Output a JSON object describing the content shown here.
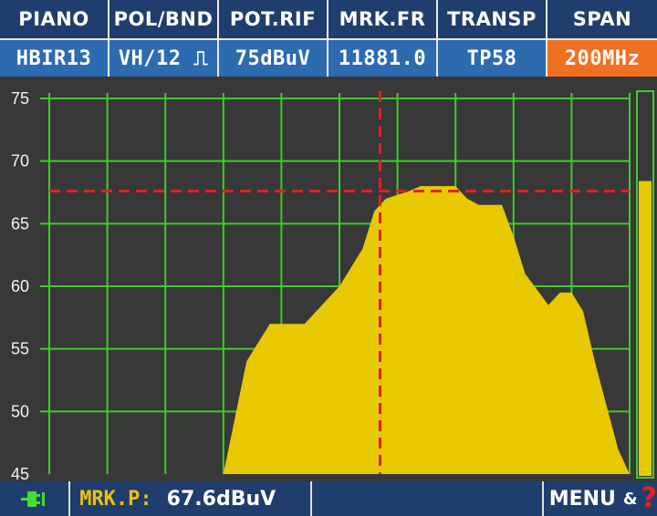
{
  "header": {
    "labels": [
      "PIANO",
      "POL/BND",
      "POT.RIF",
      "MRK.FR",
      "TRANSP",
      "SPAN"
    ],
    "values": [
      "HBIR13",
      "VH/12 ⎍",
      "75dBuV",
      "11881.0",
      "TP58",
      "200MHz"
    ]
  },
  "chart_data": {
    "type": "area",
    "title": "",
    "xlabel": "",
    "ylabel": "",
    "ylim": [
      45,
      75
    ],
    "yticks": [
      75,
      70,
      65,
      60,
      55,
      50,
      45
    ],
    "grid": true,
    "colors": {
      "fill": "#e8c800",
      "grid": "#3ecc2a",
      "marker": "#e22020"
    },
    "series": [
      {
        "x": [
          0,
          30,
          34,
          38,
          44,
          50,
          54,
          56,
          58,
          62,
          64,
          66,
          70,
          72,
          74,
          78,
          80,
          82,
          86,
          88,
          90,
          92,
          94,
          98,
          100
        ],
        "y": [
          45,
          45,
          54,
          57,
          57,
          60,
          63,
          66,
          67,
          67.6,
          68,
          68,
          68,
          67,
          66.5,
          66.5,
          64,
          61,
          58.5,
          59.5,
          59.5,
          58,
          54,
          47,
          45
        ]
      }
    ],
    "marker": {
      "x": 57,
      "y": 67.6
    },
    "level_bar": 0.77
  },
  "footer": {
    "plug_icon": "plug-icon",
    "marker_label": "MRK.P:",
    "marker_value": "67.6dBuV",
    "menu_label": "MENU",
    "amp": "&",
    "help_symbol": "?"
  }
}
